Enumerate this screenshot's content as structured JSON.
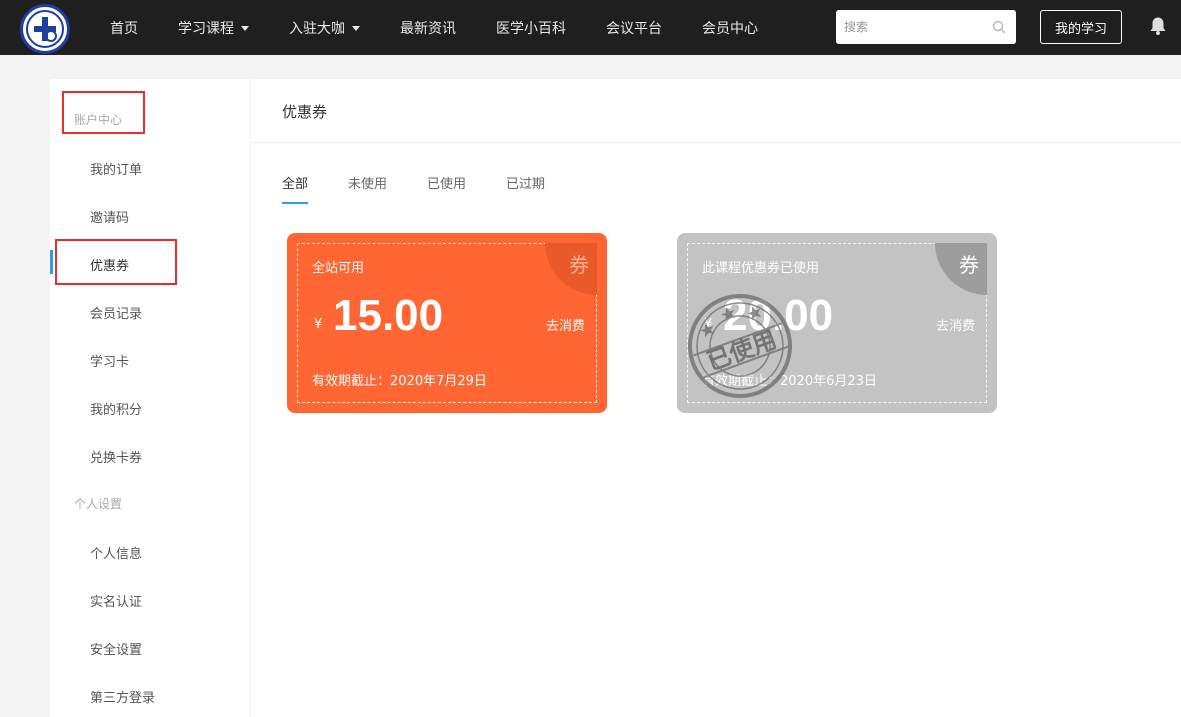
{
  "header": {
    "nav": [
      {
        "label": "首页",
        "dropdown": false
      },
      {
        "label": "学习课程",
        "dropdown": true
      },
      {
        "label": "入驻大咖",
        "dropdown": true
      },
      {
        "label": "最新资讯",
        "dropdown": false
      },
      {
        "label": "医学小百科",
        "dropdown": false
      },
      {
        "label": "会议平台",
        "dropdown": false
      },
      {
        "label": "会员中心",
        "dropdown": false
      }
    ],
    "search_placeholder": "搜索",
    "my_study_label": "我的学习"
  },
  "sidebar": {
    "group1": "账户中心",
    "items1": [
      "我的订单",
      "邀请码",
      "优惠券",
      "会员记录",
      "学习卡",
      "我的积分",
      "兑换卡券"
    ],
    "group2": "个人设置",
    "items2": [
      "个人信息",
      "实名认证",
      "安全设置",
      "第三方登录"
    ],
    "active": "优惠券"
  },
  "main": {
    "title": "优惠券",
    "tabs": [
      "全部",
      "未使用",
      "已使用",
      "已过期"
    ],
    "active_tab": "全部",
    "coupons": [
      {
        "scope": "全站可用",
        "currency": "¥",
        "amount": "15.00",
        "action": "去消费",
        "expire_label": "有效期截止：",
        "expire_date": "2020年7月29日",
        "corner": "券",
        "status": "available",
        "color": "#ff6633"
      },
      {
        "scope": "此课程优惠券已使用",
        "currency": "¥",
        "amount": "20.00",
        "action": "去消费",
        "expire_label": "有效期截止：",
        "expire_date": "2020年6月23日",
        "corner": "券",
        "status": "used",
        "stamp": "已使用",
        "color": "#c3c3c3"
      }
    ]
  },
  "colors": {
    "topbar": "#1f1f1f",
    "accent": "#2e9fe6",
    "highlight": "#e53030"
  }
}
